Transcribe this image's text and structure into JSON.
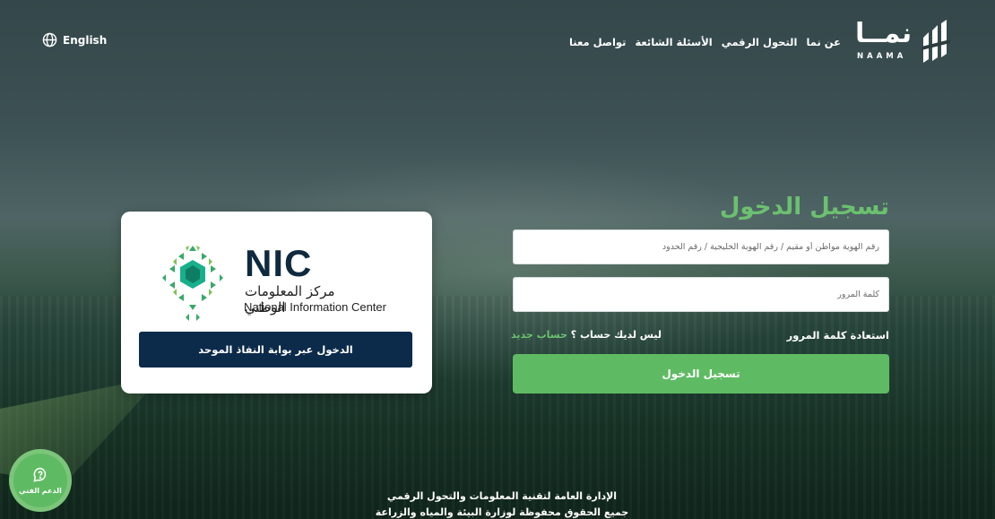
{
  "header": {
    "language_label": "English",
    "nav_items": [
      "عن نما",
      "التحول الرقمي",
      "الأسئلة الشائعة",
      "تواصل معنا"
    ],
    "logo_ar": "نمــا",
    "logo_en": "NAAMA"
  },
  "login": {
    "title": "تسجيل الدخول",
    "id_placeholder": "رقم الهوية مواطن أو مقيم / رقم الهوية الخليجية / رقم الحدود",
    "password_placeholder": "كلمة المرور",
    "forgot_password": "استعادة كلمة المرور",
    "no_account": "ليس لديك حساب ؟",
    "new_account": "حساب جديد",
    "submit": "تسجيل الدخول"
  },
  "nic": {
    "abbr": "NIC",
    "name_ar": "مركز المعلومات الوطني",
    "name_en": "National Information Center",
    "button": "الدخول عبر بوابة النفاذ الموحد"
  },
  "support": {
    "label": "الدعم الفني"
  },
  "footer": {
    "line1": "الإدارة العامة لتقنية المعلومات والتحول الرقمي",
    "line2": "جميع الحقوق محفوظة لوزارة البيئة والمياه والزراعة"
  },
  "colors": {
    "accent_green": "#5fbb63",
    "nic_navy": "#0c2b4b",
    "title_green": "#6cc070"
  },
  "icons": {
    "language": "globe-icon",
    "support": "chat-question-icon",
    "logo": "naama-logo-icon",
    "nic": "nic-emblem-icon"
  }
}
